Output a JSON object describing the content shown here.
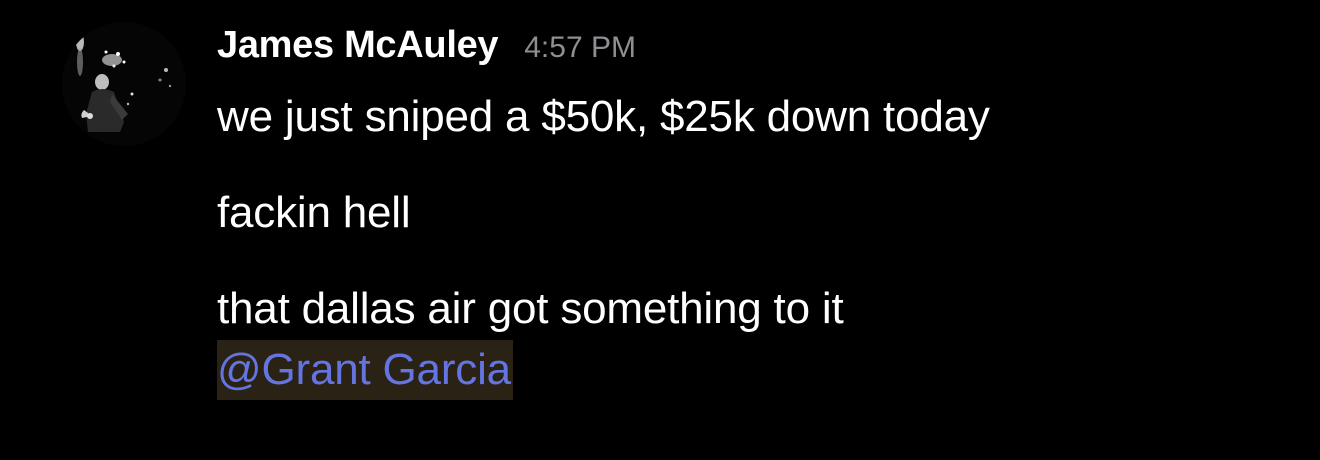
{
  "message": {
    "author": "James McAuley",
    "timestamp": "4:57 PM",
    "lines": [
      "we just sniped a $50k, $25k down today",
      "fackin hell",
      "that dallas air got something to it"
    ],
    "mention": "@Grant Garcia"
  },
  "colors": {
    "background": "#000000",
    "text": "#ffffff",
    "timestamp": "#8e8e93",
    "mention_text": "#6474e0",
    "mention_highlight": "#2a2214"
  },
  "icons": {
    "avatar": "user-avatar-photo"
  }
}
